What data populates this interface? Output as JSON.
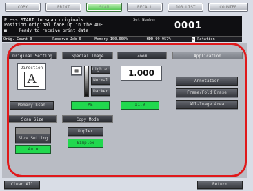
{
  "tabs": [
    "COPY",
    "PRINT",
    "SCAN",
    "RECALL",
    "JOB LIST",
    "COUNTER"
  ],
  "message": {
    "line1": "Press START to scan originals",
    "line2": "Position original face up in the ADF",
    "line3": "Ready to receive print data",
    "set_number_label": "Set Number",
    "set_number_value": "0001"
  },
  "statusbar": {
    "orig_count": "Orig. Count    0",
    "reserve_job": "Reserve Job    0",
    "memory": "Memory  100.000%",
    "hdd": "HDD    99.957%",
    "rotation": "Rotation"
  },
  "original_setting": {
    "header": "Original Setting",
    "direction_label": "Direction",
    "direction_letter": "A",
    "memory_scan": "Memory Scan"
  },
  "special_image": {
    "header": "Special Image",
    "options": [
      "Lighter",
      "Normal",
      "Darker"
    ],
    "ae": "AE"
  },
  "zoom": {
    "header": "Zoom",
    "value": "1.000",
    "button": "x1.0"
  },
  "application": {
    "header": "Application",
    "buttons": [
      "Annotation",
      "Frame/Fold Erase",
      "All-Image Area"
    ]
  },
  "scan_size": {
    "header": "Scan Size",
    "size_setting": "Size Setting",
    "auto": "Auto"
  },
  "copy_mode": {
    "header": "Copy Mode",
    "duplex": "Duplex",
    "simplex": "Simplex"
  },
  "bottom": {
    "clear_all": "Clear All",
    "return": "Return"
  },
  "colors": {
    "active_green": "#21d84e",
    "highlight_red": "#e0191b",
    "message_bg": "#0f0f12"
  }
}
